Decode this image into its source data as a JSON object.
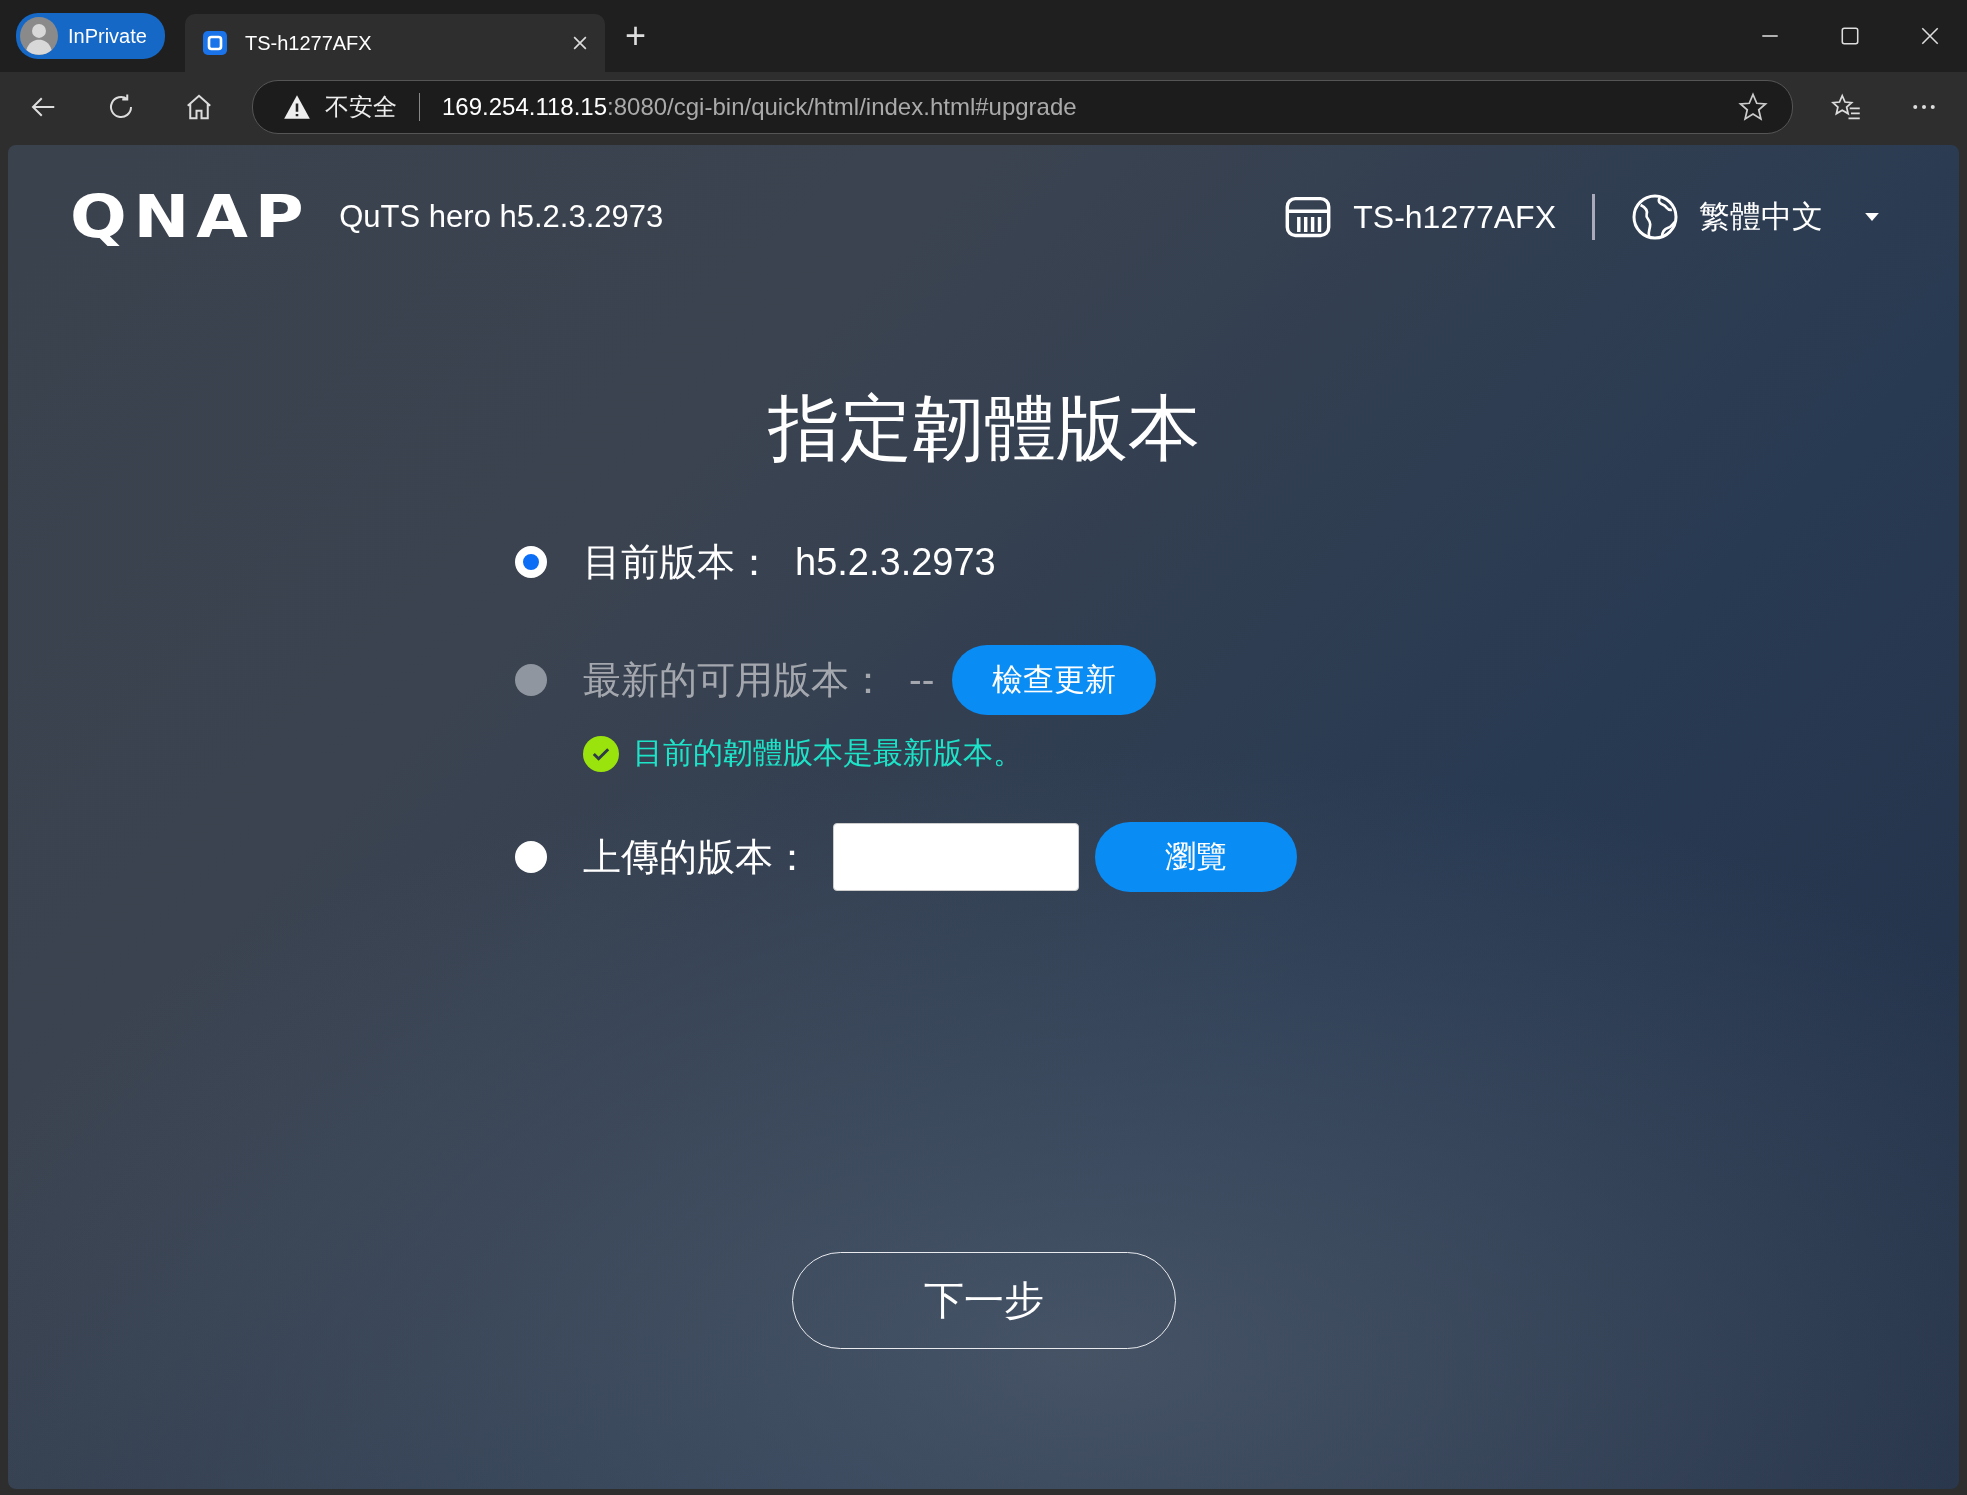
{
  "browser": {
    "profile_label": "InPrivate",
    "tabs": [
      {
        "title": "TS-h1277AFX",
        "selected": true
      }
    ],
    "new_tab": "+",
    "address": {
      "warning": "不安全",
      "host": "169.254.118.15",
      "path": ":8080/cgi-bin/quick/html/index.html#upgrade"
    }
  },
  "header": {
    "brand": "QNAP",
    "product": "QuTS hero h5.2.3.2973",
    "device": "TS-h1277AFX",
    "language": "繁體中文"
  },
  "title": "指定韌體版本",
  "options": [
    {
      "kind": "current",
      "label": "目前版本：",
      "value": "h5.2.3.2973",
      "selected": true,
      "disabled": false
    },
    {
      "kind": "latest",
      "label": "最新的可用版本：",
      "value": "--",
      "button": "檢查更新",
      "status": "目前的韌體版本是最新版本。",
      "selected": false,
      "disabled": true
    },
    {
      "kind": "upload",
      "label": "上傳的版本：",
      "button": "瀏覽",
      "selected": false,
      "disabled": false
    }
  ],
  "next_button": "下一步"
}
